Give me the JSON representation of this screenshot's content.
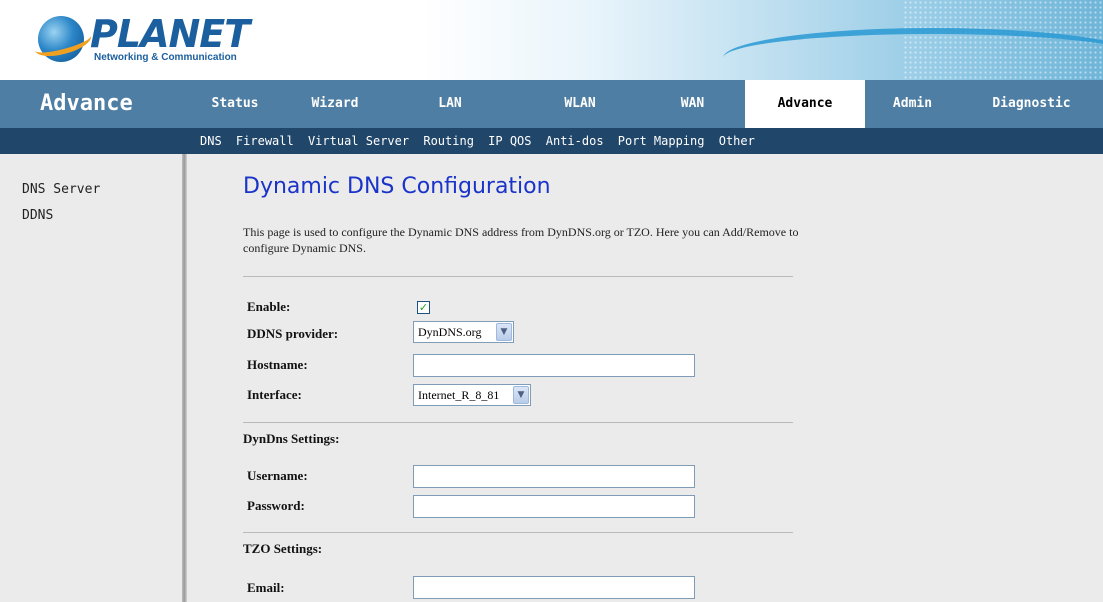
{
  "brand": {
    "name": "PLANET",
    "tagline": "Networking & Communication"
  },
  "nav": {
    "section_title": "Advance",
    "tabs": [
      {
        "label": "Status",
        "active": false
      },
      {
        "label": "Wizard",
        "active": false
      },
      {
        "label": "LAN",
        "active": false
      },
      {
        "label": "WLAN",
        "active": false
      },
      {
        "label": "WAN",
        "active": false
      },
      {
        "label": "Advance",
        "active": true
      },
      {
        "label": "Admin",
        "active": false
      },
      {
        "label": "Diagnostic",
        "active": false
      }
    ]
  },
  "subnav": {
    "items": [
      "DNS",
      "Firewall",
      "Virtual Server",
      "Routing",
      "IP QOS",
      "Anti-dos",
      "Port Mapping",
      "Other"
    ]
  },
  "sidebar": {
    "items": [
      "DNS Server",
      "DDNS"
    ]
  },
  "main": {
    "title": "Dynamic DNS Configuration",
    "description": "This page is used to configure the Dynamic DNS address from DynDNS.org or TZO. Here you can Add/Remove to configure Dynamic DNS.",
    "form": {
      "enable_label": "Enable:",
      "enable_checked": true,
      "provider_label": "DDNS provider:",
      "provider_value": "DynDNS.org",
      "hostname_label": "Hostname:",
      "hostname_value": "",
      "interface_label": "Interface:",
      "interface_value": "Internet_R_8_81"
    },
    "dyndns": {
      "section_label": "DynDns Settings:",
      "username_label": "Username:",
      "username_value": "",
      "password_label": "Password:",
      "password_value": ""
    },
    "tzo": {
      "section_label": "TZO Settings:",
      "email_label": "Email:",
      "email_value": ""
    }
  },
  "colors": {
    "nav_bg": "#4e7ea3",
    "subnav_bg": "#20466a",
    "title_blue": "#1a33c8",
    "content_bg": "#ebebeb"
  }
}
